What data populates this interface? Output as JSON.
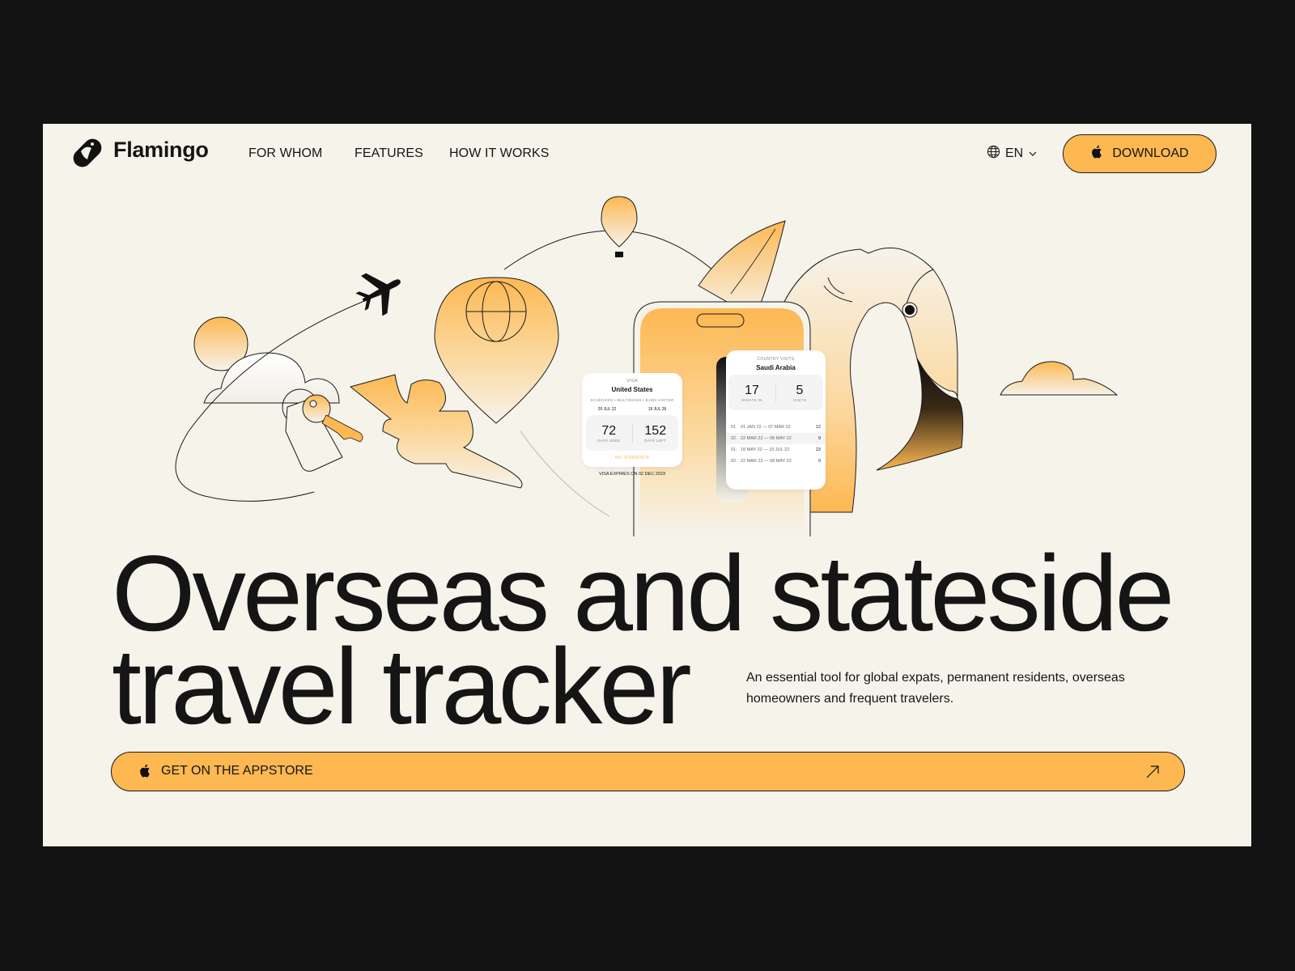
{
  "brand": {
    "name": "Flamingo",
    "logo_icon": "flamingo-logo-icon"
  },
  "nav": {
    "items": [
      {
        "label": "FOR WHOM"
      },
      {
        "label": "FEATURES"
      },
      {
        "label": "HOW IT WORKS"
      }
    ]
  },
  "language": {
    "icon": "globe-icon",
    "value": "EN",
    "chevron": "chevron-down-icon"
  },
  "download_button": {
    "label": "DOWNLOAD",
    "icon": "apple-icon"
  },
  "hero": {
    "line1": "Overseas and stateside",
    "line2": "travel tracker",
    "description": "An essential tool for global expats, permanent residents, overseas homeowners and frequent travelers."
  },
  "appstore_button": {
    "label": "GET ON THE APPSTORE",
    "icon": "apple-icon",
    "arrow": "arrow-up-right-icon"
  },
  "visa_card": {
    "kicker": "VISA",
    "country": "United States",
    "details": "SCHENGEN • MULTI90/180 • B1/B2 VISITER",
    "start_date": "20 JUL 22",
    "end_date": "19 JUL 26",
    "days_used": "72",
    "days_used_label": "DAYS USED",
    "days_left": "152",
    "days_left_label": "DAYS LEFT",
    "number": "NO: 0786687678",
    "expires": "VISA EXPIRES ON 02 DEC 2023"
  },
  "visits_card": {
    "kicker": "COUNTRY VISITS",
    "country": "Saudi Arabia",
    "nights": "17",
    "nights_label": "NIGHTS IN",
    "visits": "5",
    "visits_label": "VISITS",
    "rows": [
      {
        "idx": "01.",
        "range": "01 JAN 22 — 07 MAR 22",
        "count": "12"
      },
      {
        "idx": "02.",
        "range": "22 MAR 22 — 08 MAY 22",
        "count": "9"
      },
      {
        "idx": "01.",
        "range": "18 MAY 22 — 10 JUL 22",
        "count": "23"
      },
      {
        "idx": "02.",
        "range": "22 MAR 22 — 08 MAY 22",
        "count": "9"
      }
    ]
  },
  "colors": {
    "accent": "#fdb852",
    "background": "#f6f3eb",
    "outer": "#131313",
    "text": "#151515"
  }
}
